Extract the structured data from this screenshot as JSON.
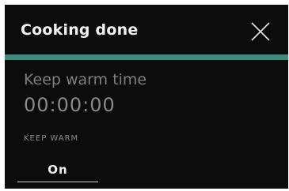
{
  "dialog": {
    "title": "Cooking done",
    "close_icon": "close-icon",
    "accent_color": "#3b8c80"
  },
  "keep_warm": {
    "label": "Keep warm time",
    "time": "00:00:00",
    "section_label": "KEEP WARM",
    "toggle_value": "On"
  }
}
